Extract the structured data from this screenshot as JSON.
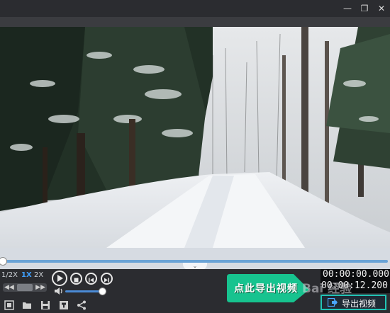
{
  "window": {
    "controls": [
      {
        "icon": "minimize-icon",
        "glyph": "—"
      },
      {
        "icon": "restore-icon",
        "glyph": "❐"
      },
      {
        "icon": "close-icon",
        "glyph": "✕"
      }
    ]
  },
  "speed": {
    "options": [
      "1/2X",
      "1X",
      "2X"
    ],
    "selected": "1X",
    "slider_left": "◀◀",
    "slider_right": "▶▶"
  },
  "playback": {
    "buttons": [
      "play-icon",
      "stop-icon",
      "previous-frame-icon",
      "next-frame-icon"
    ]
  },
  "volume": {
    "level": 0.92,
    "icon": "speaker-icon"
  },
  "time": {
    "current": "00:00:00.000",
    "total": "00:00:12.200"
  },
  "progress": {
    "fraction": 0.0
  },
  "toolbar": {
    "icons": [
      "clip-icon",
      "open-folder-icon",
      "save-icon",
      "snapshot-icon",
      "share-icon"
    ]
  },
  "annotation": {
    "banner_text": "点此导出视频",
    "banner_color": "#17c38f",
    "highlight_color": "#21c4b6"
  },
  "export": {
    "label": "导出视频"
  },
  "watermark": {
    "text": "Bai  经验"
  },
  "colors": {
    "accent": "#3fa0ff",
    "timeline_track": "#6aa3d6"
  }
}
